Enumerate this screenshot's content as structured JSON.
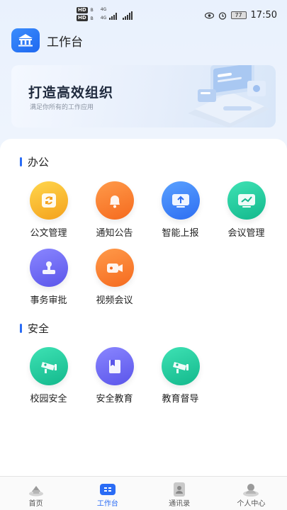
{
  "status": {
    "net1": "HD",
    "net1_sub": "B",
    "net2": "HD",
    "net2_sub": "B",
    "gen1": "4G",
    "gen2": "4G",
    "battery": "77",
    "time": "17:50"
  },
  "header": {
    "title": "工作台"
  },
  "banner": {
    "title": "打造高效组织",
    "subtitle": "满足你所有的工作应用"
  },
  "sections": [
    {
      "title": "办公",
      "items": [
        {
          "label": "公文管理",
          "icon": "document-sync-icon",
          "color": "#f7b52a"
        },
        {
          "label": "通知公告",
          "icon": "bell-icon",
          "color": "#f77a2c"
        },
        {
          "label": "智能上报",
          "icon": "monitor-upload-icon",
          "color": "#3b7ff5"
        },
        {
          "label": "会议管理",
          "icon": "monitor-chart-icon",
          "color": "#1fc69a"
        },
        {
          "label": "事务审批",
          "icon": "approval-stamp-icon",
          "color": "#6b66f2"
        },
        {
          "label": "视频会议",
          "icon": "video-camera-icon",
          "color": "#f77a2c"
        }
      ]
    },
    {
      "title": "安全",
      "items": [
        {
          "label": "校园安全",
          "icon": "surveillance-camera-icon",
          "color": "#1fc69a"
        },
        {
          "label": "安全教育",
          "icon": "book-icon",
          "color": "#6b66f2"
        },
        {
          "label": "教育督导",
          "icon": "surveillance-camera-icon",
          "color": "#1fc69a"
        }
      ]
    }
  ],
  "tabbar": [
    {
      "label": "首页",
      "icon": "home-icon"
    },
    {
      "label": "工作台",
      "icon": "workbench-icon",
      "active": true
    },
    {
      "label": "通讯录",
      "icon": "contacts-icon"
    },
    {
      "label": "个人中心",
      "icon": "person-icon"
    }
  ]
}
